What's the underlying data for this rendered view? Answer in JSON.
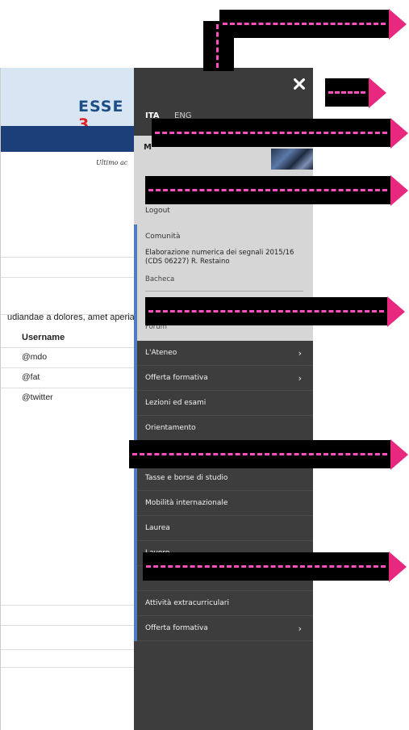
{
  "background_page": {
    "logo_main": "ESSE",
    "logo_num": "3",
    "ultimo_text": "Ultimo ac",
    "body_snippet": "udiandae a dolores, amet aperia",
    "table": {
      "header": "Username",
      "rows": [
        "@mdo",
        "@fat",
        "@twitter"
      ]
    }
  },
  "drawer": {
    "close_icon": "close-icon",
    "languages": [
      "ITA",
      "ENG"
    ],
    "user_initial": "M",
    "logout": "Logout",
    "community": {
      "title": "Comunità",
      "course": "Elaborazione numerica dei segnali 2015/16 (CDS 06227) R. Restaino",
      "bacheca": "Bacheca",
      "forum": "Forum"
    },
    "menu": [
      {
        "label": "L'Ateneo",
        "chevron": "›"
      },
      {
        "label": "Offerta formativa",
        "chevron": "›"
      },
      {
        "label": "Lezioni ed esami",
        "chevron": ""
      },
      {
        "label": "Orientamento",
        "chevron": ""
      },
      {
        "label": "",
        "chevron": ""
      },
      {
        "label": "Tasse e borse di studio",
        "chevron": ""
      },
      {
        "label": "Mobilità internazionale",
        "chevron": ""
      },
      {
        "label": "Laurea",
        "chevron": ""
      },
      {
        "label": "Lavoro",
        "chevron": ""
      },
      {
        "label": "",
        "chevron": ""
      },
      {
        "label": "Attività extracurriculari",
        "chevron": ""
      },
      {
        "label": "Offerta formativa",
        "chevron": "›"
      }
    ]
  },
  "colors": {
    "drawer_bg": "#3d3d3d",
    "accent": "#4f7cc0",
    "arrow": "#e7287e",
    "header_blue": "#1c3f7a"
  }
}
